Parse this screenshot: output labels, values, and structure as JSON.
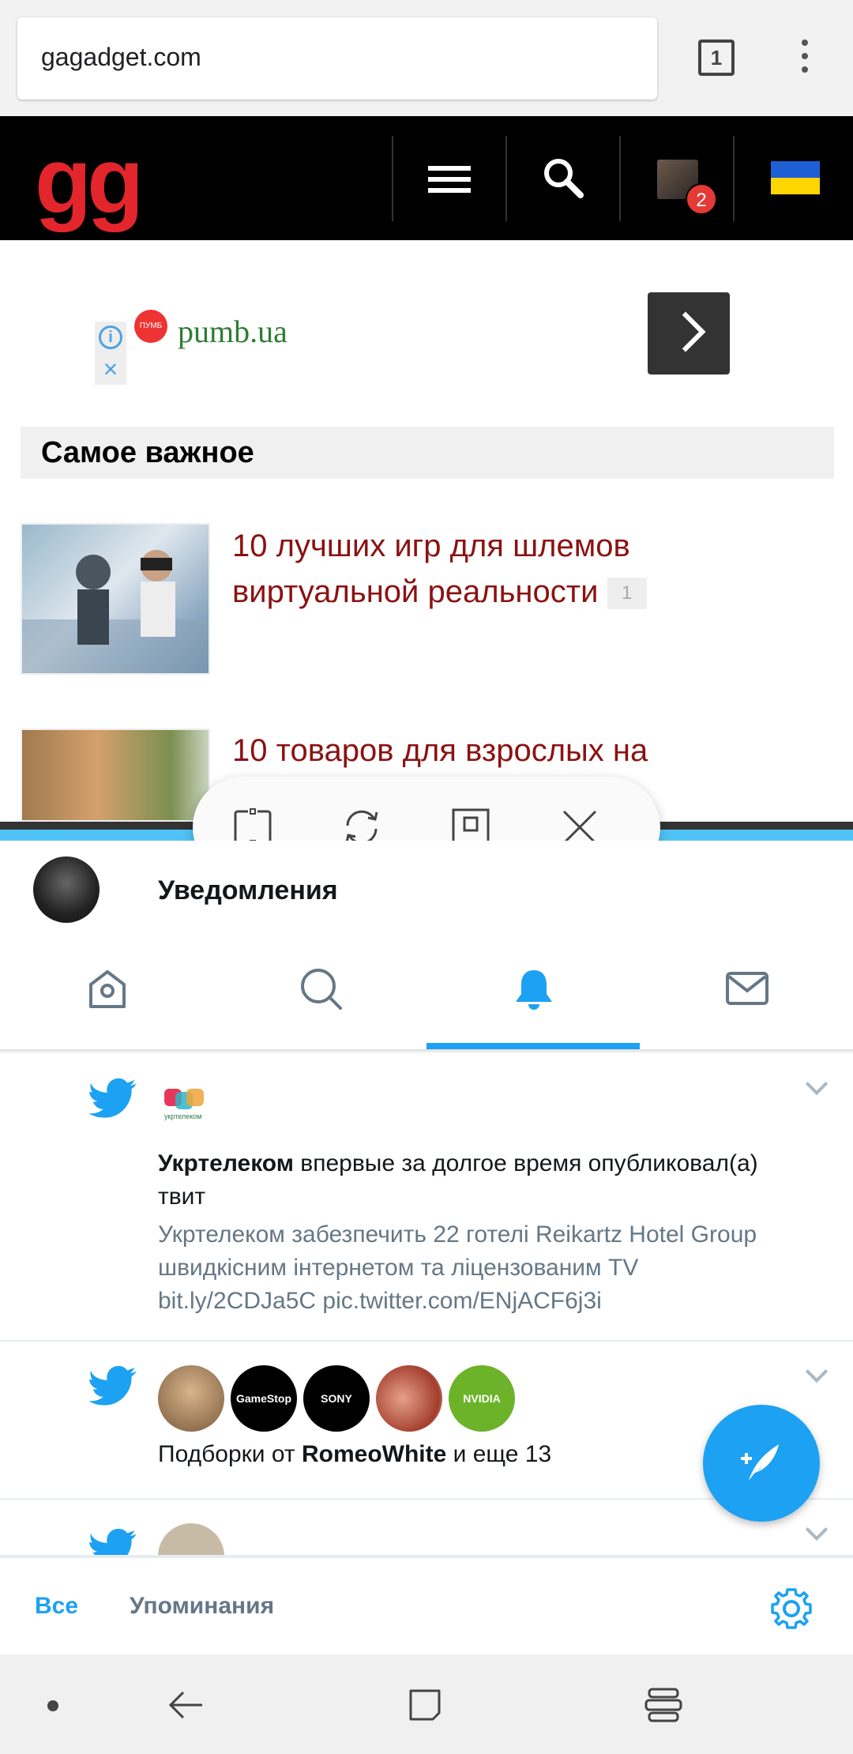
{
  "browser": {
    "url": "gagadget.com",
    "tab_count": "1"
  },
  "site": {
    "logo": "gg",
    "notification_count": "2"
  },
  "ad": {
    "logo_text": "ПУМБ",
    "domain": "pumb.ua"
  },
  "section": {
    "title": "Самое важное"
  },
  "articles": [
    {
      "title": "10 лучших игр для шлемов виртуальной реальности",
      "comments": "1"
    },
    {
      "title": "10 товаров для взрослых на"
    }
  ],
  "twitter": {
    "header_title": "Уведомления",
    "tabs": [
      "home",
      "search",
      "notifications",
      "messages"
    ],
    "active_tab": "notifications",
    "notifications": [
      {
        "account_logo_text": "укртелеком",
        "account": "Укртелеком",
        "action": " впервые за долгое время опубликовал(а) твит",
        "snippet": "Укртелеком забезпечить 22 готелі Reikartz Hotel Group швидкісним інтернетом та ліцензованим TV bit.ly/2CDJa5C pic.twitter.com/ENjACF6j3i"
      },
      {
        "avatars": [
          "",
          "GameStop",
          "SONY",
          "",
          "NVIDIA"
        ],
        "prefix": "Подборки от ",
        "user": "RomeoWhite",
        "suffix": " и еще 13"
      }
    ],
    "bottom_tabs": {
      "all": "Все",
      "mentions": "Упоминания"
    },
    "accent_color": "#1da1f2"
  },
  "split_controls": [
    "resize-icon",
    "swap-icon",
    "maximize-icon",
    "close-icon"
  ]
}
